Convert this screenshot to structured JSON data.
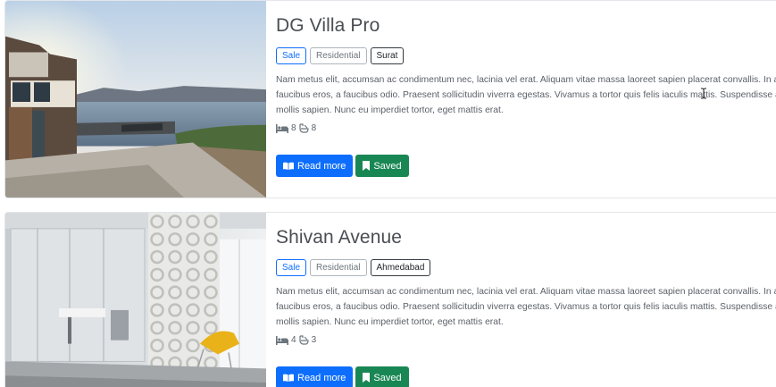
{
  "listings": [
    {
      "title": "DG Villa Pro",
      "badges": {
        "sale": "Sale",
        "type": "Residential",
        "city": "Surat"
      },
      "description": "Nam metus elit, accumsan ac condimentum nec, lacinia vel erat. Aliquam vitae massa laoreet sapien placerat convallis. In a faucibus eros, a faucibus odio. Praesent sollicitudin viverra egestas. Vivamus a tortor quis felis iaculis mattis. Suspendisse a mollis sapien. Nunc eu imperdiet tortor, eget mattis erat.",
      "beds": "8",
      "baths": "8",
      "read_more": "Read more",
      "saved": "Saved",
      "image_icon": "villa-photo"
    },
    {
      "title": "Shivan Avenue",
      "badges": {
        "sale": "Sale",
        "type": "Residential",
        "city": "Ahmedabad"
      },
      "description": "Nam metus elit, accumsan ac condimentum nec, lacinia vel erat. Aliquam vitae massa laoreet sapien placerat convallis. In a faucibus eros, a faucibus odio. Praesent sollicitudin viverra egestas. Vivamus a tortor quis felis iaculis mattis. Suspendisse a mollis sapien. Nunc eu imperdiet tortor, eget mattis erat.",
      "beds": "4",
      "baths": "3",
      "read_more": "Read more",
      "saved": "Saved",
      "image_icon": "office-photo"
    }
  ],
  "colors": {
    "primary": "#0d6efd",
    "success": "#198754",
    "secondary": "#6c757d"
  }
}
